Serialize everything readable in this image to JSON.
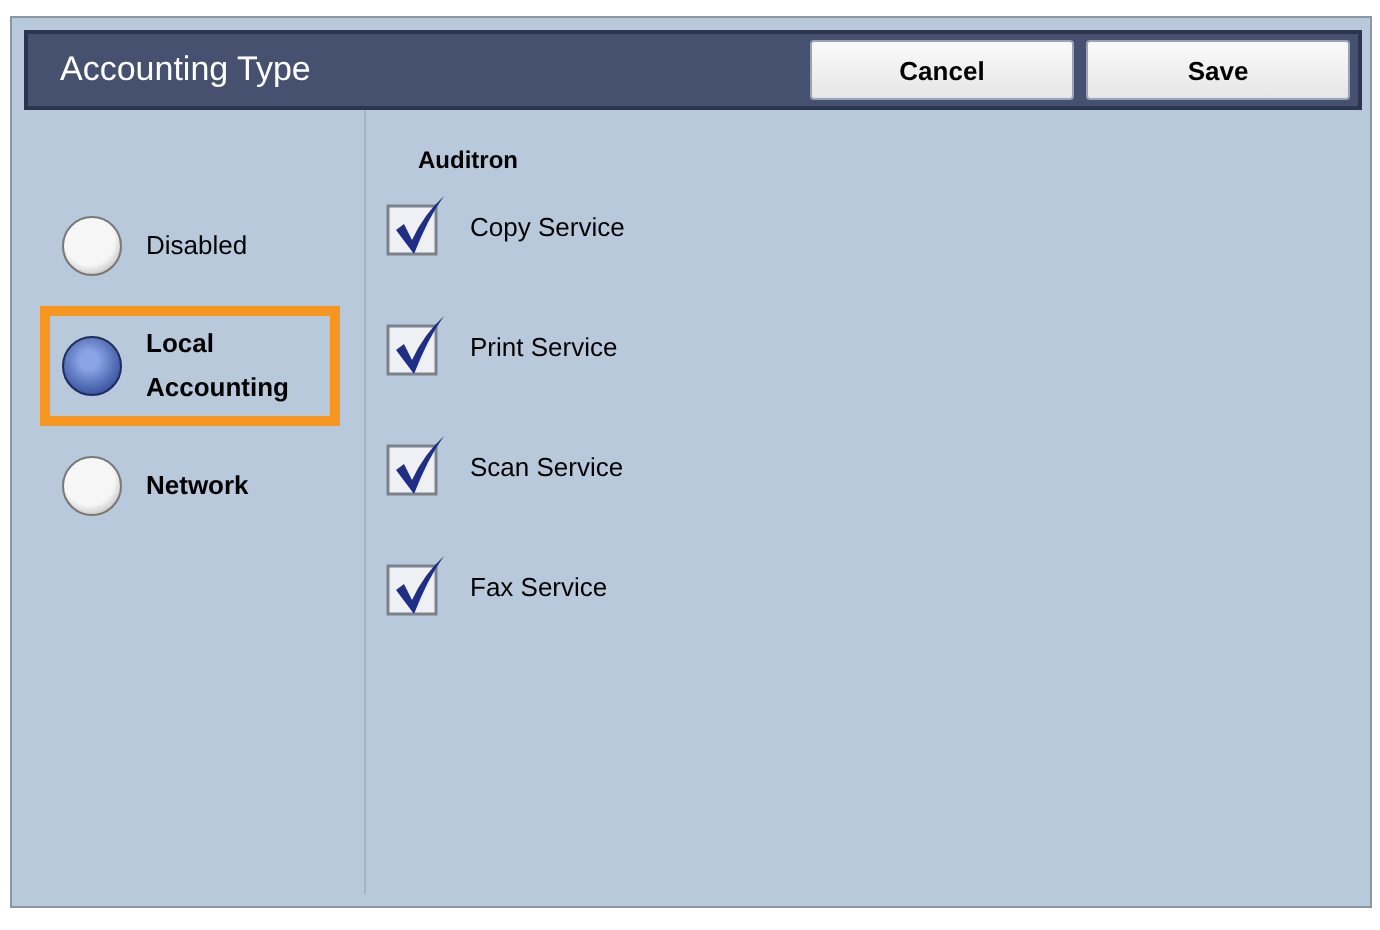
{
  "header": {
    "title": "Accounting Type",
    "buttons": [
      "Cancel",
      "Save"
    ]
  },
  "options": [
    {
      "label": "Disabled",
      "selected": false,
      "bold": false,
      "highlighted": false
    },
    {
      "label": "Local Accounting",
      "selected": true,
      "bold": true,
      "highlighted": true
    },
    {
      "label": "Network",
      "selected": false,
      "bold": true,
      "highlighted": false
    }
  ],
  "auditron": {
    "title": "Auditron",
    "services": [
      {
        "label": "Copy Service",
        "checked": true
      },
      {
        "label": "Print Service",
        "checked": true
      },
      {
        "label": "Scan Service",
        "checked": true
      },
      {
        "label": "Fax Service",
        "checked": true
      }
    ]
  }
}
